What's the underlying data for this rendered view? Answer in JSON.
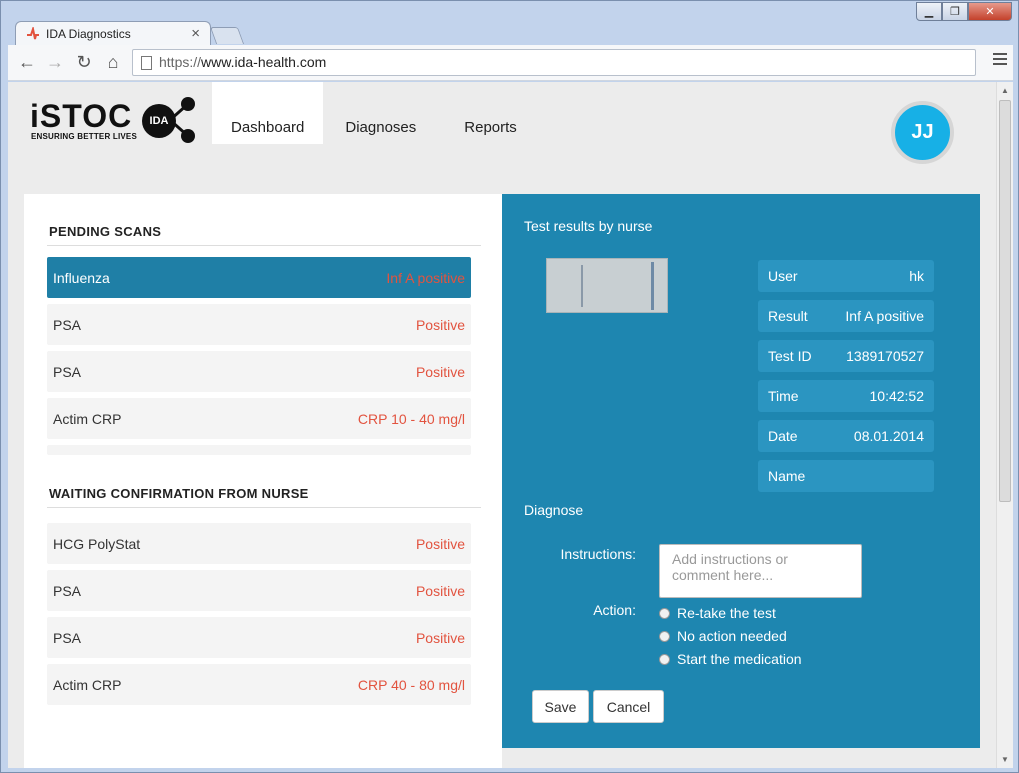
{
  "browser": {
    "tab_title": "IDA Diagnostics",
    "tab_close": "×",
    "url_scheme": "https://",
    "url_host": "www.ida-health.com",
    "window_buttons": [
      "▁",
      "❐",
      "✕"
    ]
  },
  "brand": {
    "wordmark": "iSTOC",
    "badge": "IDA",
    "tagline": "ENSURING BETTER LIVES"
  },
  "nav": {
    "items": [
      "Dashboard",
      "Diagnoses",
      "Reports"
    ],
    "active": "Dashboard"
  },
  "user": {
    "initials": "JJ"
  },
  "pending": {
    "title": "PENDING SCANS",
    "rows": [
      {
        "name": "Influenza",
        "value": "Inf A positive"
      },
      {
        "name": "PSA",
        "value": "Positive"
      },
      {
        "name": "PSA",
        "value": "Positive"
      },
      {
        "name": "Actim CRP",
        "value": "CRP 10 - 40 mg/l"
      }
    ]
  },
  "waiting": {
    "title": "WAITING CONFIRMATION FROM NURSE",
    "rows": [
      {
        "name": "HCG PolyStat",
        "value": "Positive"
      },
      {
        "name": "PSA",
        "value": "Positive"
      },
      {
        "name": "PSA",
        "value": "Positive"
      },
      {
        "name": "Actim CRP",
        "value": "CRP 40 - 80 mg/l"
      }
    ]
  },
  "details": {
    "title": "Test results by nurse",
    "fields": [
      {
        "label": "User",
        "value": "hk"
      },
      {
        "label": "Result",
        "value": "Inf A positive"
      },
      {
        "label": "Test ID",
        "value": "1389170527"
      },
      {
        "label": "Time",
        "value": "10:42:52"
      },
      {
        "label": "Date",
        "value": "08.01.2014"
      },
      {
        "label": "Name",
        "value": ""
      }
    ]
  },
  "diagnose": {
    "title": "Diagnose",
    "instructions_label": "Instructions:",
    "instructions_placeholder": "Add instructions or comment here...",
    "action_label": "Action:",
    "actions": [
      "Re-take the test",
      "No action needed",
      "Start the medication"
    ],
    "save_label": "Save",
    "cancel_label": "Cancel"
  },
  "colors": {
    "accent": "#1e86b0",
    "selected_row": "#1f7fa6",
    "positive_text": "#e2533f",
    "avatar": "#17b0e6"
  }
}
